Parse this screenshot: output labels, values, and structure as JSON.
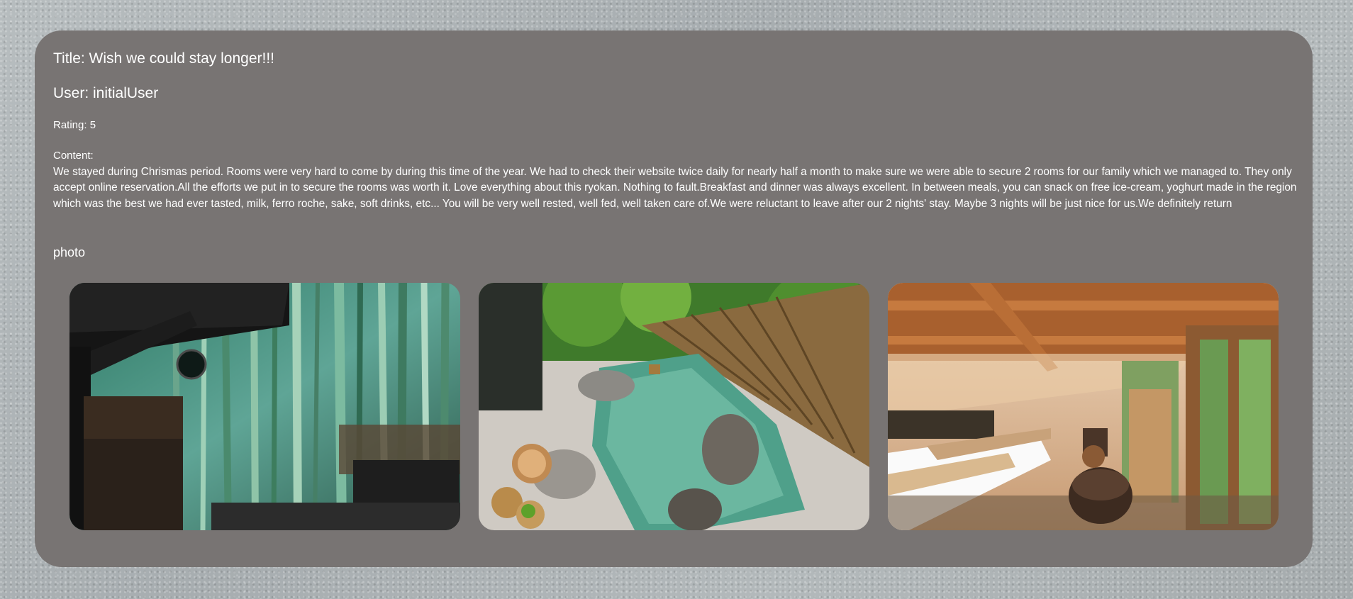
{
  "review": {
    "title": "Title: Wish we could stay longer!!!",
    "user": "User: initialUser",
    "rating_label": "Rating: ",
    "rating_value": "5",
    "content_label": "Content:",
    "content_text": "We stayed during Chrismas period. Rooms were very hard to come by during this time of the year. We had to check their website twice daily for nearly half a month to make sure we were able to secure 2 rooms for our family which we managed to. They only accept online reservation.All the efforts we put in to secure the rooms was worth it. Love everything about this ryokan. Nothing to fault.Breakfast and dinner was always excellent. In between meals, you can snack on free ice-cream, yoghurt made in the region which was the best we had ever tasted, milk, ferro roche, sake, soft drinks, etc... You will be very well rested, well fed, well taken care of.We were reluctant to leave after our 2 nights' stay. Maybe 3 nights will be just nice for us.We definitely return",
    "photo_label": "photo"
  },
  "photos": [
    {
      "subject": "bamboo-forest"
    },
    {
      "subject": "outdoor-hot-spring"
    },
    {
      "subject": "ryokan-bedroom"
    }
  ],
  "colors": {
    "card": "#787473",
    "text": "#ffffff"
  }
}
